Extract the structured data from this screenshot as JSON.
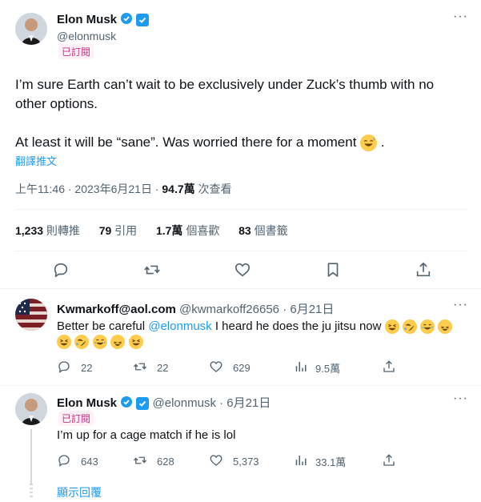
{
  "main_tweet": {
    "name": "Elon Musk",
    "handle": "@elonmusk",
    "subscribed": "已訂閱",
    "text_line1": "I’m sure Earth can’t wait to be exclusively under Zuck’s thumb with no",
    "text_line2": "other options.",
    "text_line3": "At least it will be “sane”. Was worried there for a moment",
    "text_end": ".",
    "translate": "翻譯推文",
    "timestamp": "上午11:46 · 2023年6月21日 · ",
    "views_value": "94.7萬",
    "views_label": " 次查看",
    "stats": {
      "retweets_value": "1,233",
      "retweets_label": " 則轉推",
      "quotes_value": "79",
      "quotes_label": " 引用",
      "likes_value": "1.7萬",
      "likes_label": " 個喜歡",
      "bookmarks_value": "83",
      "bookmarks_label": " 個書籤"
    }
  },
  "reply1": {
    "name": "Kwmarkoff@aol.com",
    "handle": "@kwmarkoff26656",
    "date": "· 6月21日",
    "text_prefix": "Better be careful ",
    "mention": "@elonmusk",
    "text_suffix": " I heard he does the ju jitsu now",
    "replies": "22",
    "retweets": "22",
    "likes": "629",
    "views": "9.5萬"
  },
  "reply2": {
    "name": "Elon Musk",
    "handle": "@elonmusk",
    "date": "· 6月21日",
    "subscribed": "已訂閱",
    "text": "I’m up for a cage match if he is lol",
    "replies": "643",
    "retweets": "628",
    "likes": "5,373",
    "views": "33.1萬"
  },
  "show_replies": "顯示回覆",
  "colors": {
    "accent": "#1d9bf0",
    "muted": "#536471",
    "subscribed": "#c13584"
  }
}
